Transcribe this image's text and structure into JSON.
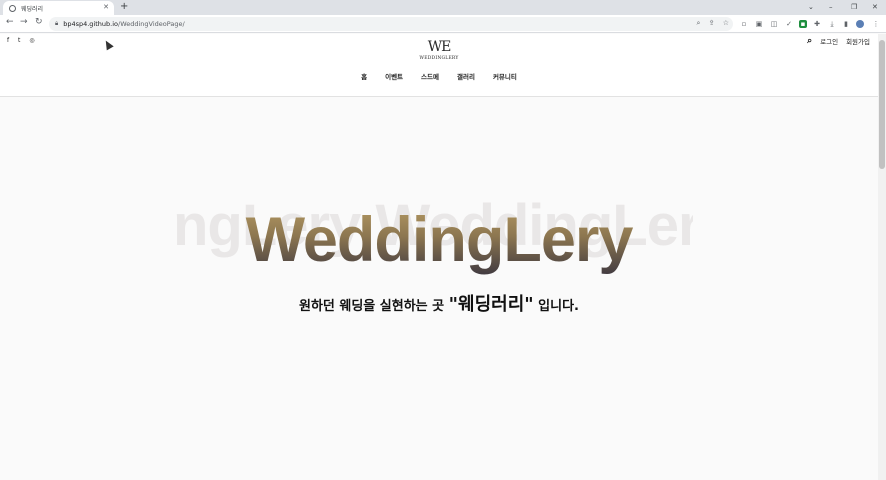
{
  "browser": {
    "tab_title": "웨딩러리",
    "tab_close": "✕",
    "new_tab": "+",
    "url_host": "bp4sp4.github.io",
    "url_path": "/WeddingVideoPage/",
    "nav_back": "←",
    "nav_forward": "→",
    "nav_reload": "↻",
    "window_controls": [
      "⌄",
      "–",
      "❐",
      "✕"
    ]
  },
  "site": {
    "social": [
      "f",
      "t",
      "◎"
    ],
    "logo_mark": "WE",
    "logo_sub": "WEDDINGLERY",
    "search_icon": "⌕",
    "login": "로그인",
    "signup": "회원가입",
    "menu": [
      "홈",
      "이벤트",
      "스드메",
      "갤러리",
      "커뮤니티"
    ]
  },
  "hero": {
    "background_text": "ngLery WeddingLery",
    "title": "WeddingLery",
    "tagline_pre": "원하던 웨딩을 실현하는 곳 ",
    "tagline_brand": "\"웨딩러리\"",
    "tagline_post": " 입니다."
  }
}
